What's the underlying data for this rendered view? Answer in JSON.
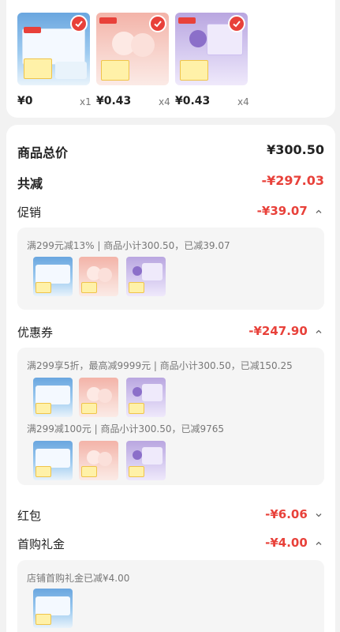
{
  "products": [
    {
      "price": "¥0",
      "qty": "x1",
      "theme": "blue"
    },
    {
      "price": "¥0.43",
      "qty": "x4",
      "theme": "pink"
    },
    {
      "price": "¥0.43",
      "qty": "x4",
      "theme": "purple"
    }
  ],
  "summary": {
    "total_label": "商品总价",
    "total_value": "¥300.50",
    "reduce_label": "共减",
    "reduce_value": "-¥297.03"
  },
  "promo": {
    "label": "促销",
    "value": "-¥39.07",
    "detail": "满299元减13% | 商品小计300.50，已减39.07"
  },
  "coupon": {
    "label": "优惠券",
    "value": "-¥247.90",
    "detail1": "满299享5折，最高减9999元 | 商品小计300.50，已减150.25",
    "detail2": "满299减100元 | 商品小计300.50，已减9765"
  },
  "redpacket": {
    "label": "红包",
    "value": "-¥6.06"
  },
  "gift": {
    "label": "首购礼金",
    "value": "-¥4.00",
    "detail": "店铺首购礼金已减¥4.00"
  },
  "colors": {
    "accent": "#e8413a",
    "panel_bg": "#f5f5f5",
    "page_bg": "#f2f2f2"
  },
  "icons": [
    "check-icon",
    "chevron-up-icon",
    "chevron-down-icon"
  ]
}
